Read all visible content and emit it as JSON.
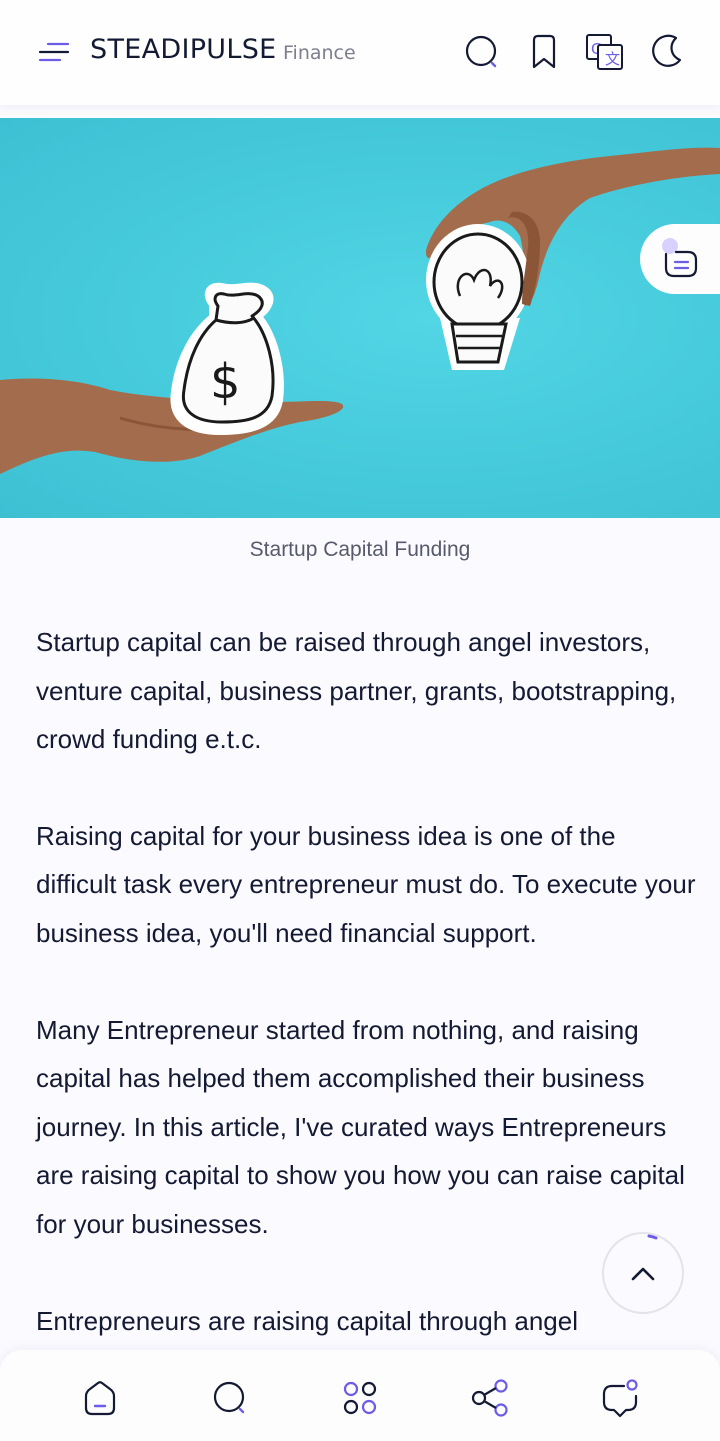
{
  "header": {
    "brand": "STEADIPULSE",
    "section": "Finance",
    "icons": [
      "menu-icon",
      "search-icon",
      "bookmark-icon",
      "translate-icon",
      "moon-icon"
    ]
  },
  "hero": {
    "caption": "Startup Capital Funding",
    "background_color": "#45cadb"
  },
  "article": {
    "paragraphs": [
      "Startup capital can be raised through angel investors, venture capital, business partner, grants, bootstrapping, crowd funding e.t.c.",
      "Raising capital for your business idea is one of the difficult task every entrepreneur must do. To execute your business idea, you'll need financial support.",
      "Many Entrepreneur started from nothing, and raising capital has helped them accomplished their business journey. In this article, I've curated ways Entrepreneurs are raising capital to show you how you can raise capital for your businesses.",
      "Entrepreneurs are raising capital through angel"
    ]
  },
  "bottom_nav": {
    "items": [
      "home-icon",
      "search-icon",
      "apps-icon",
      "share-icon",
      "comment-icon"
    ]
  },
  "colors": {
    "accent": "#6c5ce7",
    "text": "#141a33",
    "muted": "#7d7f8f"
  }
}
